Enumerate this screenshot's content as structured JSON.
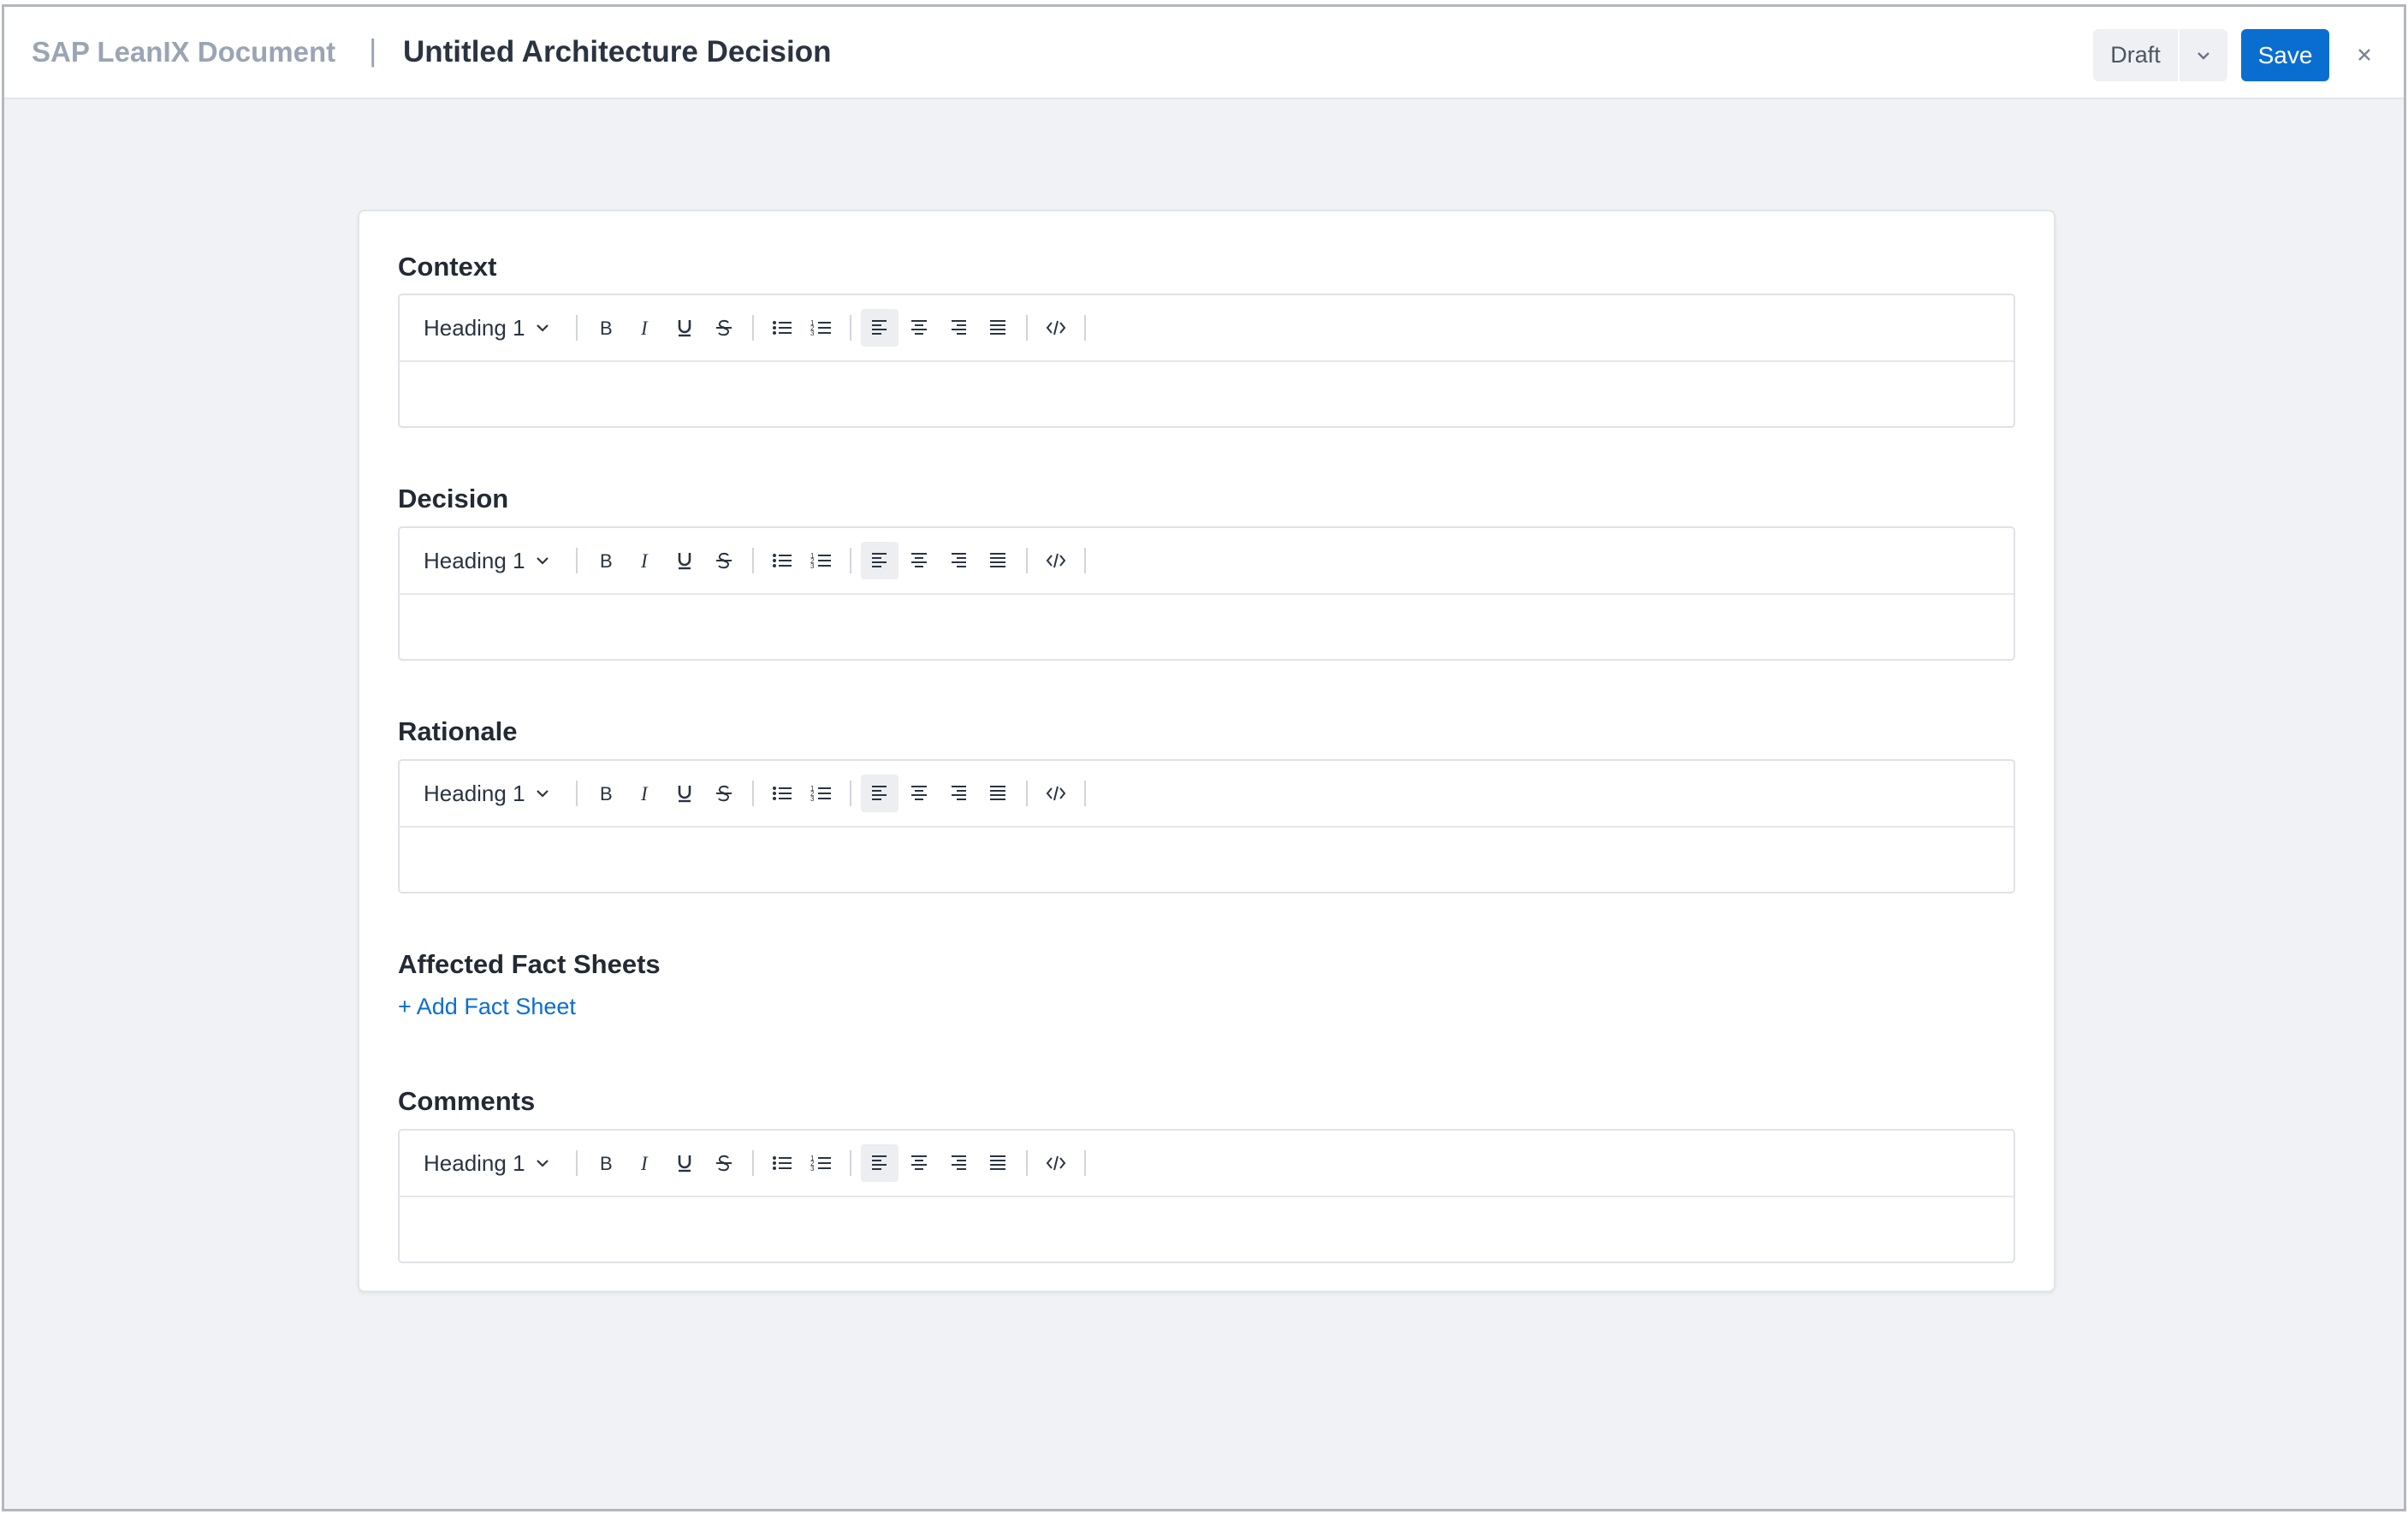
{
  "header": {
    "brand": "SAP LeanIX Document",
    "separator": "|",
    "title": "Untitled Architecture Decision",
    "status_label": "Draft",
    "save_label": "Save",
    "close_icon": "close-icon",
    "status_caret_icon": "chevron-down-icon"
  },
  "colors": {
    "accent": "#0a6ed1",
    "background": "#f0f2f5",
    "brand_text": "#9aa5b4"
  },
  "toolbar": {
    "block_format": "Heading 1",
    "buttons": [
      "bold-icon",
      "italic-icon",
      "underline-icon",
      "strikethrough-icon",
      "bullet-list-icon",
      "numbered-list-icon",
      "align-left-icon",
      "align-center-icon",
      "align-right-icon",
      "align-justify-icon",
      "code-icon"
    ],
    "active_button": "align-left-icon"
  },
  "sections": [
    {
      "title": "Context",
      "content": ""
    },
    {
      "title": "Decision",
      "content": ""
    },
    {
      "title": "Rationale",
      "content": ""
    },
    {
      "title": "Comments",
      "content": ""
    }
  ],
  "fact_sheets": {
    "title": "Affected Fact Sheets",
    "add_label": "+ Add Fact Sheet"
  }
}
